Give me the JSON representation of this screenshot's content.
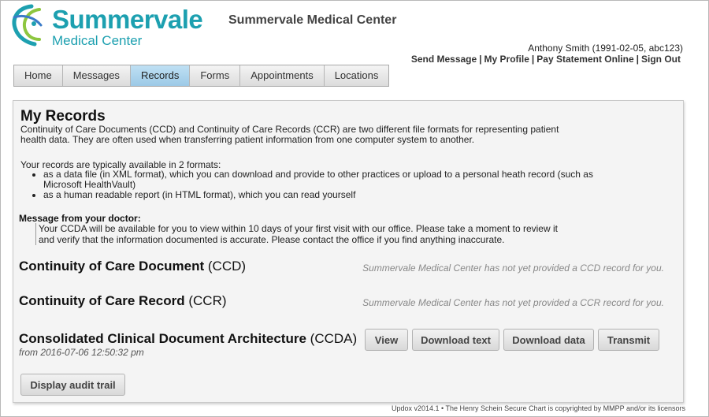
{
  "brand": {
    "logo_name": "Summervale",
    "logo_sub": "Medical Center",
    "title": "Summervale Medical Center",
    "accent_color": "#1da0b0"
  },
  "user": {
    "info": "Anthony Smith (1991-02-05, abc123)",
    "links": [
      "Send Message",
      "My Profile",
      "Pay Statement Online",
      "Sign Out"
    ]
  },
  "nav": {
    "tabs": [
      "Home",
      "Messages",
      "Records",
      "Forms",
      "Appointments",
      "Locations"
    ],
    "active": "Records"
  },
  "records": {
    "heading": "My Records",
    "intro": "Continuity of Care Documents (CCD) and Continuity of Care Records (CCR) are two different file formats for representing patient health data. They are often used when transferring patient information from one computer system to another.",
    "formats_lead": "Your records are typically available in 2 formats:",
    "formats": [
      "as a data file (in XML format), which you can download and provide to other practices or upload to a personal heath record (such as Microsoft HealthVault)",
      "as a human readable report (in HTML format), which you can read yourself"
    ],
    "message_heading": "Message from your doctor:",
    "message_body": "Your CCDA will be available for you to view within 10 days of your first visit with our office. Please take a moment to review it and verify that the information documented is accurate. Please contact the office if you find anything inaccurate.",
    "ccd": {
      "title_bold": "Continuity of Care Document",
      "title_abbr": " (CCD)",
      "note": "Summervale Medical Center has not yet provided a CCD record for you."
    },
    "ccr": {
      "title_bold": "Continuity of Care Record",
      "title_abbr": " (CCR)",
      "note": "Summervale Medical Center has not yet provided a CCR record for you."
    },
    "ccda": {
      "title_bold": "Consolidated Clinical Document Architecture",
      "title_abbr": " (CCDA)",
      "date": "from 2016-07-06 12:50:32 pm",
      "buttons": [
        "View",
        "Download text",
        "Download data",
        "Transmit"
      ]
    },
    "audit_button": "Display audit trail"
  },
  "footer": "Updox v2014.1 • The Henry Schein Secure Chart is copyrighted by MMPP and/or its licensors"
}
